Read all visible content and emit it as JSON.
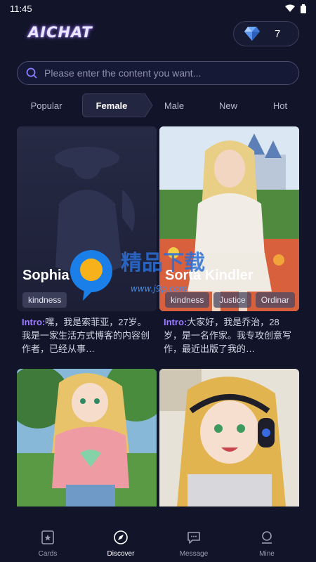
{
  "status": {
    "time": "11:45"
  },
  "header": {
    "logo": "AICHAT",
    "gem_count": "7"
  },
  "search": {
    "placeholder": "Please enter the content you want..."
  },
  "tabs": [
    {
      "label": "Popular"
    },
    {
      "label": "Female"
    },
    {
      "label": "Male"
    },
    {
      "label": "New"
    },
    {
      "label": "Hot"
    }
  ],
  "cards": [
    {
      "name": "Sophia",
      "tags": [
        "kindness"
      ],
      "intro_label": "Intro:",
      "intro_text": "嘿，我是索菲亚，27岁。我是一家生活方式博客的内容创作者，已经从事…"
    },
    {
      "name": "Sorta Kindler",
      "tags": [
        "kindness",
        "Justice",
        "Ordinar"
      ],
      "intro_label": "Intro:",
      "intro_text": "大家好，我是乔治，28岁，是一名作家。我专攻创意写作，最近出版了我的…"
    },
    {
      "name": "",
      "tags": []
    },
    {
      "name": "",
      "tags": []
    }
  ],
  "watermark": {
    "text": "精品下载",
    "url": "www.j9p.com"
  },
  "nav": [
    {
      "label": "Cards",
      "icon": "cards-icon"
    },
    {
      "label": "Discover",
      "icon": "compass-icon"
    },
    {
      "label": "Message",
      "icon": "chat-icon"
    },
    {
      "label": "Mine",
      "icon": "user-icon"
    }
  ],
  "colors": {
    "background": "#12142a",
    "accent": "#9b7bff",
    "tab_active_bg": "#232640"
  }
}
